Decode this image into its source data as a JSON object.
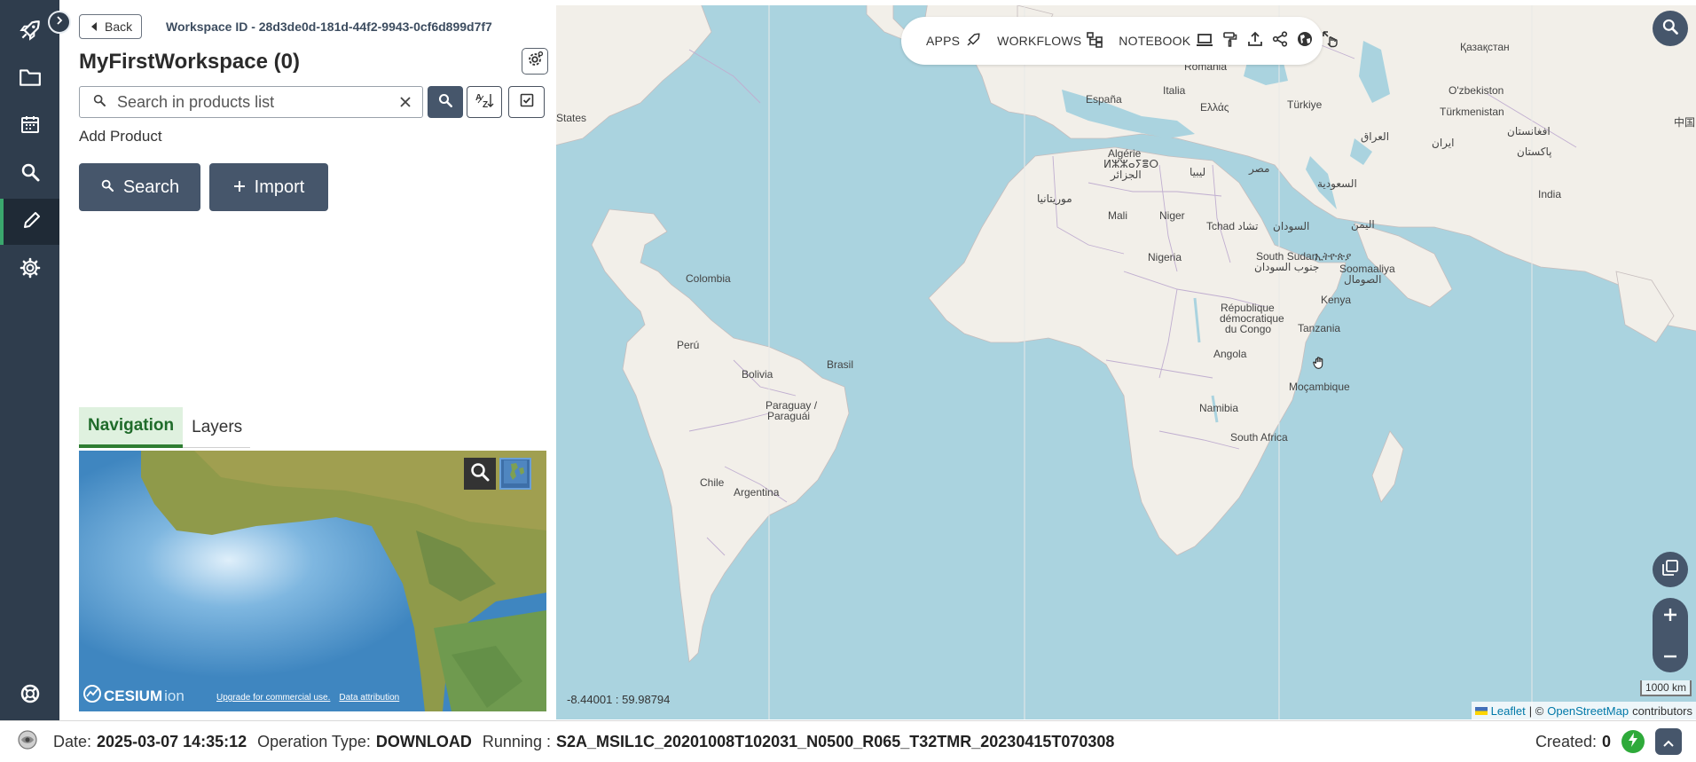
{
  "workspace": {
    "back_label": "Back",
    "id_text": "Workspace ID - 28d3de0d-181d-44f2-9943-0cf6d899d7f7",
    "title": "MyFirstWorkspace (0)",
    "search_placeholder": "Search in products list",
    "add_product_label": "Add Product",
    "search_button": "Search",
    "import_button": "Import"
  },
  "tabs": [
    {
      "label": "Navigation",
      "active": true
    },
    {
      "label": "Layers",
      "active": false
    }
  ],
  "globe": {
    "logo_text": "CESIUM",
    "logo_suffix": "ion",
    "upgrade_link": "Upgrade for commercial use.",
    "attribution_link": "Data attribution"
  },
  "toolbar": {
    "apps": "APPS",
    "workflows": "WORKFLOWS",
    "notebook": "NOTEBOOK"
  },
  "map": {
    "coords": "-8.44001 : 59.98794",
    "scale": "1000 km",
    "attribution": {
      "leaflet": "Leaflet",
      "sep": "| ©",
      "osm": "OpenStreetMap",
      "contributors": "contributors"
    },
    "labels": [
      "România",
      "Қазақстан",
      "España",
      "Italia",
      "Türkiye",
      "O'zbekiston",
      "Türkmenistan",
      "Ελλάς",
      "States",
      "العراق",
      "ایران",
      "افغانستان",
      "پاکستان",
      "Algérie",
      "ⵍⵣⵣⴰⵢⴻⵔ",
      "الجزائر",
      "ليبيا",
      "مصر",
      "السعودية",
      "India",
      "موريتانيا",
      "Mali",
      "Niger",
      "Tchad تشاد",
      "السودان",
      "اليمن",
      "Nigeria",
      "South Sudan",
      "جنوب السودان",
      "ኢትዮጵያ",
      "Soomaaliya",
      "الصومال",
      "Colombia",
      "République",
      "démocratique",
      "du Congo",
      "Kenya",
      "Tanzania",
      "Perú",
      "Brasil",
      "Bolivia",
      "Angola",
      "Moçambique",
      "Paraguay /",
      "Paraguái",
      "Namibia",
      "South Africa",
      "Chile",
      "Argentina",
      "中国"
    ]
  },
  "status": {
    "date_label": "Date:",
    "date_value": "2025-03-07 14:35:12",
    "op_label": "Operation Type:",
    "op_value": "DOWNLOAD",
    "running_label": "Running :",
    "running_value": "S2A_MSIL1C_20201008T102031_N0500_R065_T32TMR_20230415T070308",
    "created_label": "Created:",
    "created_value": "0"
  },
  "colors": {
    "rail": "#2f3d4d",
    "button": "#46566b",
    "ocean": "#aad3df",
    "land": "#f2efe9",
    "active_tab": "#2e7d32",
    "status_ok": "#2eaa3a"
  }
}
